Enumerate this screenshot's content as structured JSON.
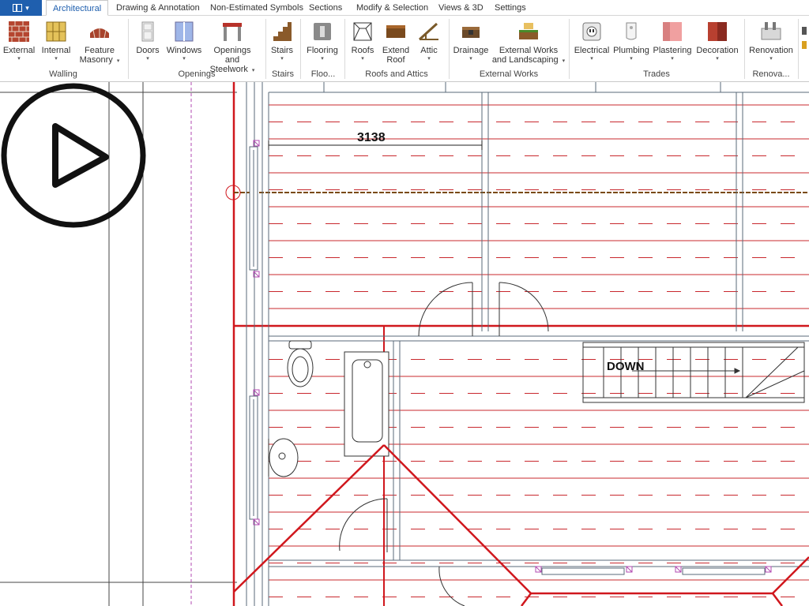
{
  "tabs": [
    {
      "label": "Architectural",
      "active": true
    },
    {
      "label": "Drawing & Annotation"
    },
    {
      "label": "Non-Estimated Symbols"
    },
    {
      "label": "Sections"
    },
    {
      "label": "Modify & Selection"
    },
    {
      "label": "Views & 3D"
    },
    {
      "label": "Settings"
    }
  ],
  "ribbon": {
    "buttons": {
      "external": {
        "line1": "External",
        "line2": ""
      },
      "internal": {
        "line1": "Internal",
        "line2": ""
      },
      "feature_masonry": {
        "line1": "Feature",
        "line2": "Masonry"
      },
      "doors": {
        "line1": "Doors",
        "line2": ""
      },
      "windows": {
        "line1": "Windows",
        "line2": ""
      },
      "openings_steelwork": {
        "line1": "Openings and",
        "line2": "Steelwork"
      },
      "stairs": {
        "line1": "Stairs",
        "line2": ""
      },
      "flooring": {
        "line1": "Flooring",
        "line2": ""
      },
      "roofs": {
        "line1": "Roofs",
        "line2": ""
      },
      "extend_roof": {
        "line1": "Extend",
        "line2": "Roof"
      },
      "attic": {
        "line1": "Attic",
        "line2": ""
      },
      "drainage": {
        "line1": "Drainage",
        "line2": ""
      },
      "external_works": {
        "line1": "External Works",
        "line2": "and Landscaping"
      },
      "electrical": {
        "line1": "Electrical",
        "line2": ""
      },
      "plumbing": {
        "line1": "Plumbing",
        "line2": ""
      },
      "plastering": {
        "line1": "Plastering",
        "line2": ""
      },
      "decoration": {
        "line1": "Decoration",
        "line2": ""
      },
      "renovation": {
        "line1": "Renovation",
        "line2": ""
      }
    },
    "groups": {
      "walling": "Walling",
      "openings": "Openings",
      "stairs": "Stairs",
      "flooring": "Floo...",
      "roofs_attics": "Roofs and Attics",
      "external_works": "External Works",
      "trades": "Trades",
      "renovation": "Renova..."
    },
    "caret": "▾"
  },
  "drawing": {
    "dimension": "3138",
    "stairs_label": "DOWN"
  },
  "colors": {
    "accent": "#1f5fae",
    "wall_red": "#d0171d",
    "joist_red": "#c8282e",
    "roof_red": "#d0171d",
    "ridge": "#7a4a10"
  },
  "icons": {
    "video": "play-icon"
  }
}
